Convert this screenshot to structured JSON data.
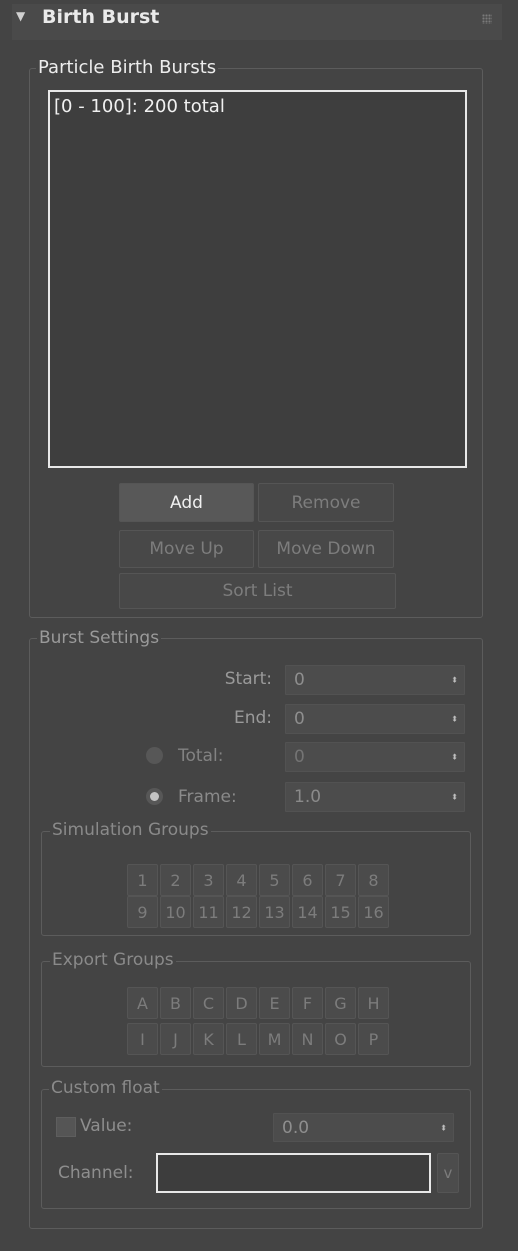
{
  "rollout": {
    "title": "Birth Burst",
    "collapse_glyph": "▼"
  },
  "particle_birth_bursts": {
    "label": "Particle Birth Bursts",
    "items": [
      "[0 - 100]: 200 total"
    ],
    "buttons": {
      "add": "Add",
      "remove": "Remove",
      "move_up": "Move Up",
      "move_down": "Move Down",
      "sort_list": "Sort List"
    }
  },
  "burst_settings": {
    "label": "Burst Settings",
    "start": {
      "label": "Start:",
      "value": "0"
    },
    "end": {
      "label": "End:",
      "value": "0"
    },
    "total": {
      "label": "Total:",
      "value": "0",
      "selected": false
    },
    "frame": {
      "label": "Frame:",
      "value": "1.0",
      "selected": true
    }
  },
  "simulation_groups": {
    "label": "Simulation Groups",
    "row1": [
      "1",
      "2",
      "3",
      "4",
      "5",
      "6",
      "7",
      "8"
    ],
    "row2": [
      "9",
      "10",
      "11",
      "12",
      "13",
      "14",
      "15",
      "16"
    ]
  },
  "export_groups": {
    "label": "Export Groups",
    "row1": [
      "A",
      "B",
      "C",
      "D",
      "E",
      "F",
      "G",
      "H"
    ],
    "row2": [
      "I",
      "J",
      "K",
      "L",
      "M",
      "N",
      "O",
      "P"
    ]
  },
  "custom_float": {
    "label": "Custom float",
    "value": {
      "label": "Value:",
      "value": "0.0",
      "checked": false
    },
    "channel": {
      "label": "Channel:",
      "value": ""
    },
    "v_button": "v"
  },
  "spinner_glyph": "⬍"
}
